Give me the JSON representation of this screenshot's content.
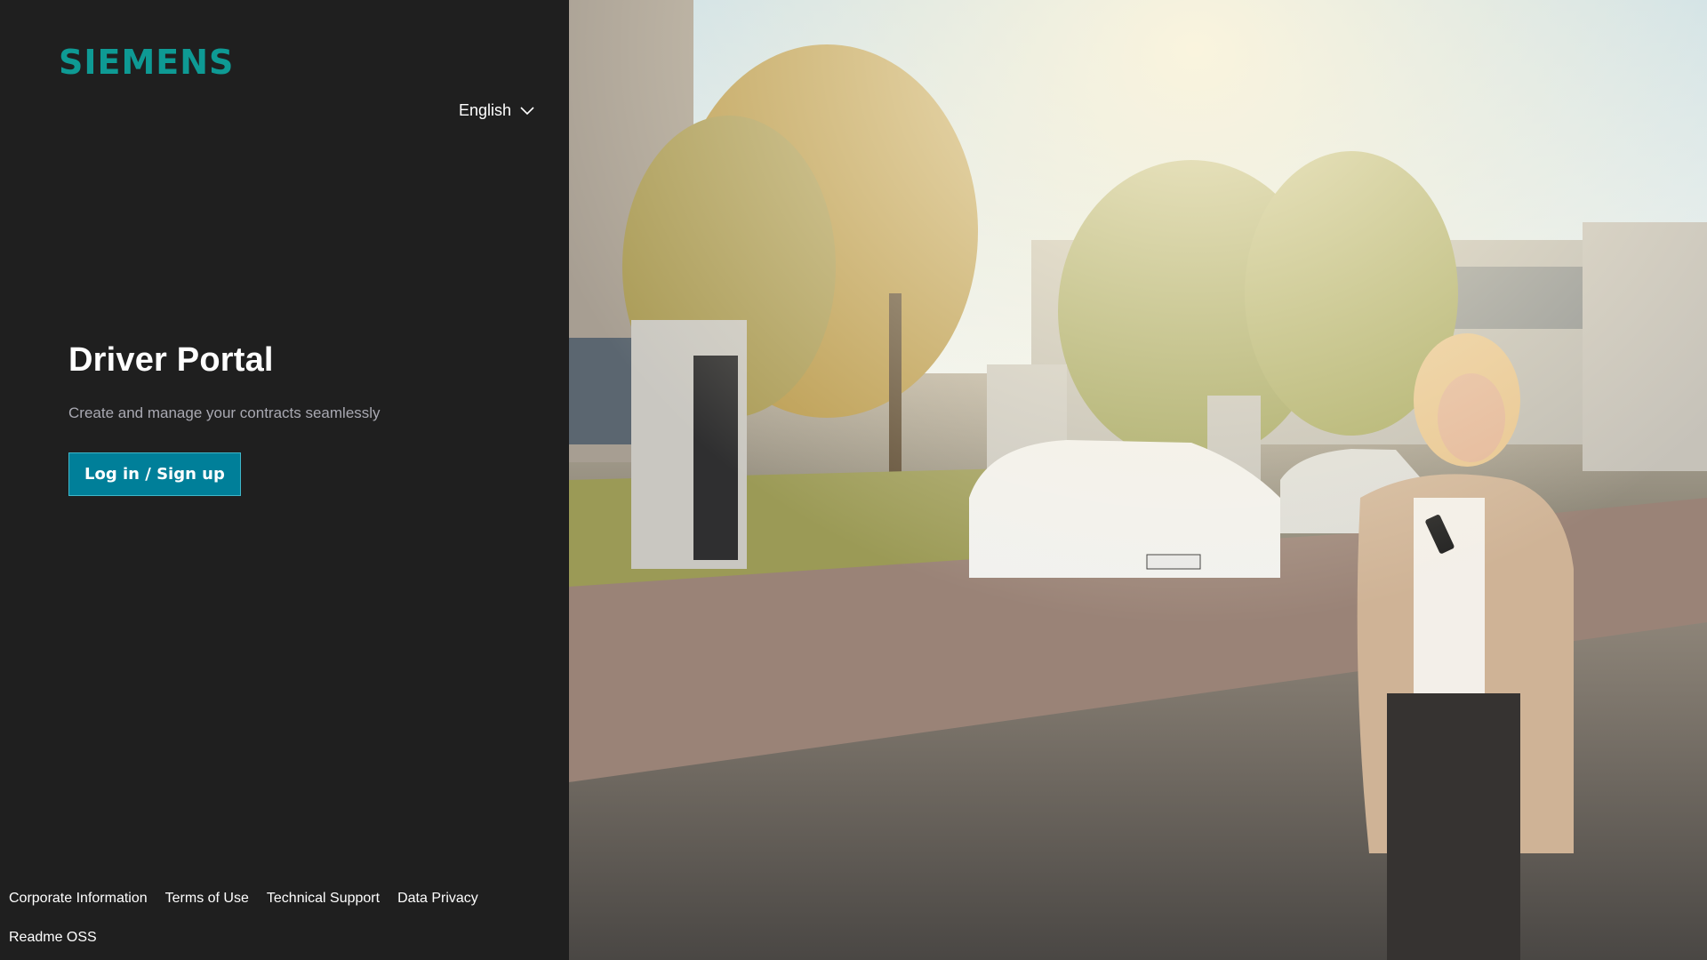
{
  "brand": {
    "logo_text": "SIEMENS",
    "logo_color": "#0e9a94"
  },
  "language": {
    "selected": "English",
    "icon": "chevron-down-icon"
  },
  "hero": {
    "title": "Driver Portal",
    "subtitle": "Create and manage your contracts seamlessly",
    "cta_label": "Log in / Sign up",
    "cta_color": "#007f99"
  },
  "footer": {
    "links_row1": [
      "Corporate Information",
      "Terms of Use",
      "Technical Support",
      "Data Privacy"
    ],
    "links_row2": [
      "Readme OSS"
    ]
  },
  "photo": {
    "description_icon": "ev-charging-scene-image"
  }
}
